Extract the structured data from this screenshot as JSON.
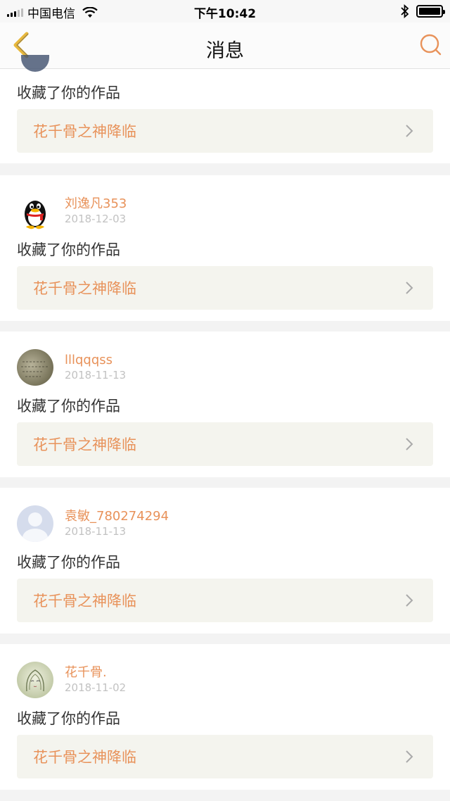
{
  "status_bar": {
    "carrier": "中国电信",
    "time": "下午10:42"
  },
  "nav": {
    "title": "消息"
  },
  "messages": [
    {
      "action": "收藏了你的作品",
      "work_title": "花千骨之神降临"
    },
    {
      "user_name": "刘逸凡353",
      "date": "2018-12-03",
      "avatar_icon": "qq-penguin-avatar",
      "action": "收藏了你的作品",
      "work_title": "花千骨之神降临"
    },
    {
      "user_name": "lllqqqss",
      "date": "2018-11-13",
      "avatar_icon": "handwriting-photo-avatar",
      "action": "收藏了你的作品",
      "work_title": "花千骨之神降临"
    },
    {
      "user_name": "袁敏_780274294",
      "date": "2018-11-13",
      "avatar_icon": "default-user-avatar",
      "action": "收藏了你的作品",
      "work_title": "花千骨之神降临"
    },
    {
      "user_name": "花千骨.",
      "date": "2018-11-02",
      "avatar_icon": "anime-drawing-avatar",
      "action": "收藏了你的作品",
      "work_title": "花千骨之神降临"
    }
  ],
  "colors": {
    "accent": "#e8925a",
    "back_arrow": "#e8b83c",
    "work_box_bg": "#f4f4ee",
    "page_bg": "#f3f3f3"
  }
}
